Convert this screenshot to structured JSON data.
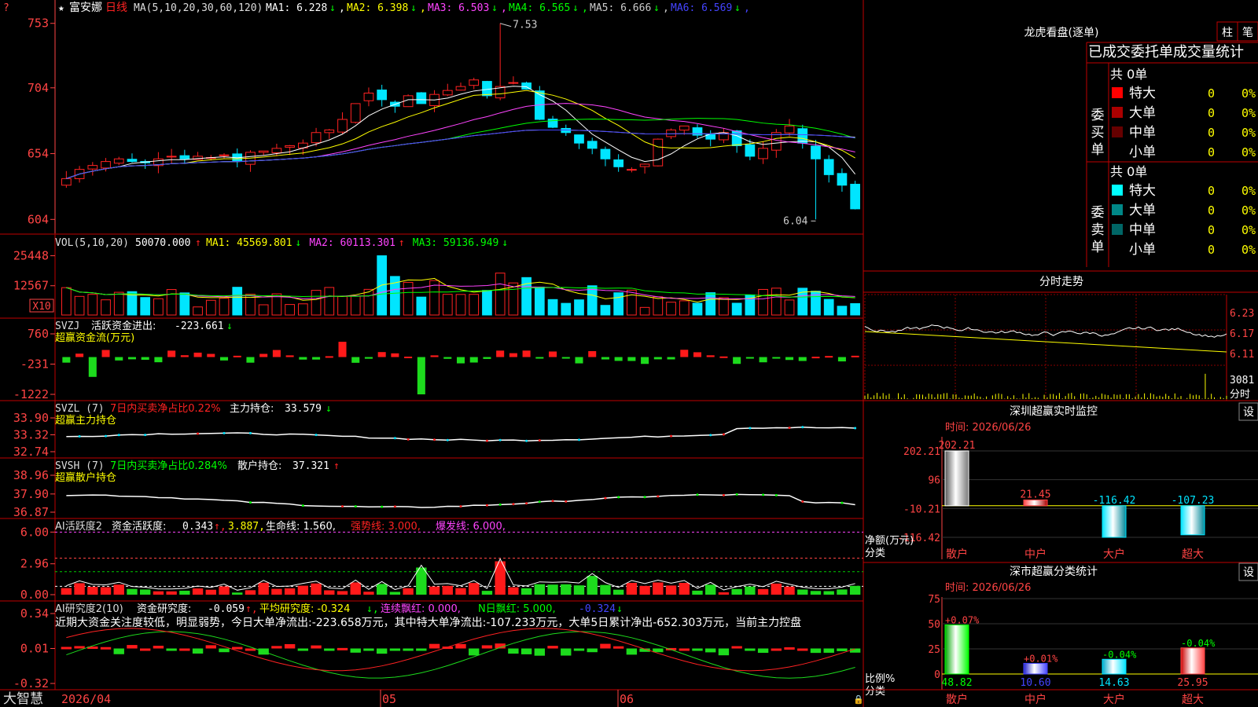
{
  "app": {
    "brand": "大智慧",
    "corner_mark": "?"
  },
  "stock": {
    "name": "富安娜",
    "period": "日线"
  },
  "colors": {
    "up": "#ff2222",
    "down": "#00e5ff",
    "grid": "#b00000",
    "axis_text": "#ff4444",
    "panel_border": "#c00000"
  },
  "main_chart": {
    "ma_header": {
      "params": "MA(5,10,20,30,60,120)",
      "items": [
        {
          "label": "MA1:",
          "value": "6.228",
          "arrow": "↓",
          "color": "#ffffff"
        },
        {
          "label": "MA2:",
          "value": "6.398",
          "arrow": "↓",
          "color": "#ffff00"
        },
        {
          "label": "MA3:",
          "value": "6.503",
          "arrow": "↓",
          "color": "#ff44ff"
        },
        {
          "label": "MA4:",
          "value": "6.565",
          "arrow": "↓",
          "color": "#00ff00"
        },
        {
          "label": "MA5:",
          "value": "6.666",
          "arrow": "↓",
          "color": "#cccccc"
        },
        {
          "label": "MA6:",
          "value": "6.569",
          "arrow": "↓",
          "color": "#4444ff"
        }
      ]
    },
    "y_ticks": [
      "753",
      "704",
      "654",
      "604"
    ],
    "high_label": "7.53",
    "low_label": "6.04"
  },
  "vol_panel": {
    "header": "VOL(5,10,20)",
    "vol_value": "50070.000",
    "vol_arrow": "↑",
    "ma": [
      {
        "label": "MA1:",
        "value": "45569.801",
        "arrow": "↓",
        "color": "#ffff00"
      },
      {
        "label": "MA2:",
        "value": "60113.301",
        "arrow": "↑",
        "color": "#ff44ff"
      },
      {
        "label": "MA3:",
        "value": "59136.949",
        "arrow": "↓",
        "color": "#00ff00"
      }
    ],
    "y_ticks": [
      "25448",
      "12567"
    ],
    "unit": "X10"
  },
  "svzj_panel": {
    "name": "SVZJ",
    "label": "活跃资金进出:",
    "value": "-223.661",
    "arrow": "↓",
    "subtitle": "超赢资金流(万元)",
    "y_ticks": [
      "760",
      "-231",
      "-1222"
    ]
  },
  "svzl_panel": {
    "name": "SVZL (7)",
    "label1": "7日内买卖净占比0.22%",
    "label2": "主力持仓:",
    "value": "33.579",
    "arrow": "↓",
    "subtitle": "超赢主力持仓",
    "y_ticks": [
      "33.90",
      "33.32",
      "32.74"
    ]
  },
  "svsh_panel": {
    "name": "SVSH (7)",
    "label1": "7日内买卖净占比0.284%",
    "label2": "散户持仓:",
    "value": "37.321",
    "arrow": "↑",
    "subtitle": "超赢散户持仓",
    "y_ticks": [
      "38.96",
      "37.90",
      "36.87"
    ]
  },
  "ai_active_panel": {
    "name": "AI活跃度2",
    "label": "资金活跃度:",
    "v1": "0.343",
    "a1": "↑",
    "v2": "3.887",
    "life_label": "生命线:",
    "life": "1.560",
    "strong_label": "强势线:",
    "strong": "3.000",
    "burst_label": "爆发线:",
    "burst": "6.000",
    "y_ticks": [
      "6.00",
      "2.96",
      "0.00"
    ]
  },
  "ai_research_panel": {
    "name": "AI研究度2(10)",
    "label": "资金研究度:",
    "value": "-0.059",
    "arrow": "↑",
    "avg_label": "平均研究度:",
    "avg": "-0.324",
    "avg_arrow": "↓",
    "red_label": "连续飘红:",
    "red": "0.000",
    "nred_label": "N日飘红:",
    "nred": "5.000",
    "last": "-0.324",
    "last_arrow": "↓",
    "comment": "近期大资金关注度较低，明显弱势，今日大单净流出:-223.658万元，其中特大单净流出:-107.233万元，大单5日累计净出-652.303万元，当前主力控盘",
    "y_ticks": [
      "0.34",
      "0.01",
      "-0.32"
    ]
  },
  "x_axis": {
    "labels": [
      "2026/04",
      "05",
      "06"
    ]
  },
  "longhu": {
    "title": "龙虎看盘(逐单)",
    "btn1": "柱",
    "btn2": "笔",
    "subtitle": "已成交委托单成交量统计",
    "buy": {
      "side": "委买单",
      "total": "共 0单",
      "rows": [
        {
          "label": "特大",
          "count": "0",
          "pct": "0%",
          "color": "#ff0000"
        },
        {
          "label": "大单",
          "count": "0",
          "pct": "0%",
          "color": "#aa0000"
        },
        {
          "label": "中单",
          "count": "0",
          "pct": "0%",
          "color": "#660000"
        },
        {
          "label": "小单",
          "count": "0",
          "pct": "0%",
          "color": "#000000"
        }
      ]
    },
    "sell": {
      "side": "委卖单",
      "total": "共 0单",
      "rows": [
        {
          "label": "特大",
          "count": "0",
          "pct": "0%",
          "color": "#00ffff"
        },
        {
          "label": "大单",
          "count": "0",
          "pct": "0%",
          "color": "#008888"
        },
        {
          "label": "中单",
          "count": "0",
          "pct": "0%",
          "color": "#006666"
        },
        {
          "label": "小单",
          "count": "0",
          "pct": "0%",
          "color": "#000000"
        }
      ]
    }
  },
  "intraday": {
    "title": "分时走势",
    "y_ticks": [
      "6.23",
      "6.17",
      "6.11"
    ],
    "vol_tick": "3081",
    "vol_unit": "分时"
  },
  "realtime": {
    "title": "深圳超赢实时监控",
    "btn": "设",
    "time": "时间: 2026/06/26",
    "y_ticks": [
      "202.21",
      "96",
      "-10.21",
      "-116.42"
    ],
    "ylabel1": "净额(万元)",
    "ylabel2": "分类",
    "chart_data": {
      "type": "bar",
      "categories": [
        "散户",
        "中户",
        "大户",
        "超大"
      ],
      "values": [
        202.21,
        21.45,
        -116.42,
        -107.23
      ],
      "value_labels": [
        "202.21",
        "21.45",
        "-116.42",
        "-107.23"
      ],
      "ylim": [
        -116.42,
        202.21
      ]
    }
  },
  "classify": {
    "title": "深市超赢分类统计",
    "btn": "设",
    "time": "时间: 2026/06/26",
    "y_ticks": [
      "75",
      "50",
      "25",
      "0"
    ],
    "ylabel1": "比例%",
    "ylabel2": "分类",
    "chart_data": {
      "type": "bar",
      "categories": [
        "散户",
        "中户",
        "大户",
        "超大"
      ],
      "values": [
        48.82,
        10.6,
        14.63,
        25.95
      ],
      "value_labels": [
        "48.82",
        "10.60",
        "14.63",
        "25.95"
      ],
      "changes": [
        "+0.07%",
        "+0.01%",
        "-0.04%",
        "-0.04%"
      ],
      "ylim": [
        0,
        75
      ]
    }
  }
}
